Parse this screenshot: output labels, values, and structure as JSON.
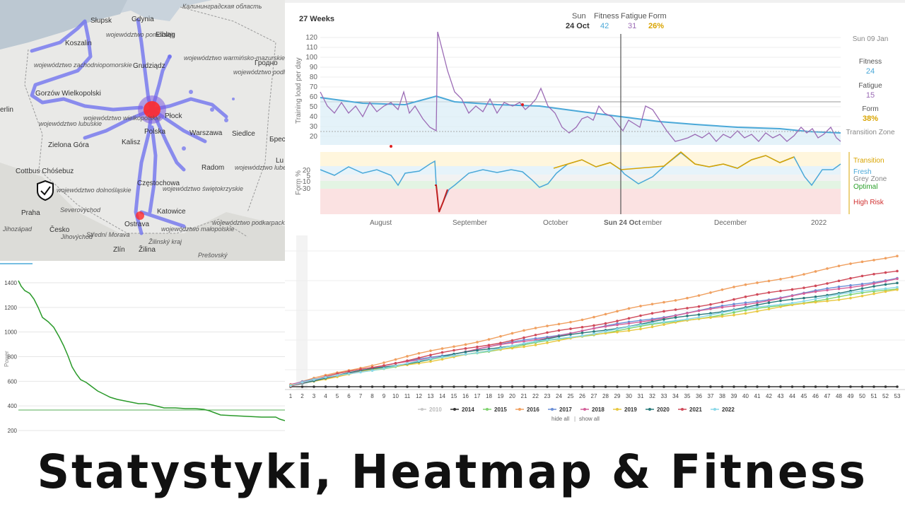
{
  "map": {
    "regions": [
      {
        "id": "zachodniopomorskie",
        "text": "województwo zachodniopomorskie"
      },
      {
        "id": "pomorskie",
        "text": "województwo pomorskie"
      },
      {
        "id": "warminsko",
        "text": "województwo warmińsko-mazurskie"
      },
      {
        "id": "podlaskie",
        "text": "województwo podlaskie"
      },
      {
        "id": "lubuskie",
        "text": "województwo lubuskie"
      },
      {
        "id": "wielkopolskie",
        "text": "województwo wielkopolskie"
      },
      {
        "id": "dolnoslaskie",
        "text": "województwo dolnośląskie"
      },
      {
        "id": "lubelskie",
        "text": "województwo lubelskie"
      },
      {
        "id": "swietokrzyskie",
        "text": "województwo świętokrzyskie"
      },
      {
        "id": "malopolskie",
        "text": "województwo małopolskie"
      },
      {
        "id": "podkarpackie",
        "text": "województwo podkarpackie"
      },
      {
        "id": "kaliningrad",
        "text": "Калининградская область"
      },
      {
        "id": "severovychod",
        "text": "Severovýchod"
      },
      {
        "id": "jihozapad",
        "text": "Jihozápad"
      },
      {
        "id": "jihovychod",
        "text": "Jihovýchod"
      },
      {
        "id": "stredni",
        "text": "Střední Morava"
      },
      {
        "id": "zilina-kraj",
        "text": "Žilinský kraj"
      },
      {
        "id": "presov",
        "text": "Prešovský"
      }
    ],
    "cities": [
      {
        "id": "slupsk",
        "text": "Słupsk"
      },
      {
        "id": "gdynia",
        "text": "Gdynia"
      },
      {
        "id": "elblag",
        "text": "Elbląg"
      },
      {
        "id": "koszalin",
        "text": "Koszalin"
      },
      {
        "id": "grodno",
        "text": "Гродно"
      },
      {
        "id": "grudziadz",
        "text": "Grudziądz"
      },
      {
        "id": "gorzow",
        "text": "Gorzów Wielkopolski"
      },
      {
        "id": "berlin",
        "text": "erlin"
      },
      {
        "id": "plock",
        "text": "Płock"
      },
      {
        "id": "polska",
        "text": "Polska"
      },
      {
        "id": "warszawa",
        "text": "Warszawa"
      },
      {
        "id": "siedlce",
        "text": "Siedlce"
      },
      {
        "id": "brest",
        "text": "Брест"
      },
      {
        "id": "cottbus",
        "text": "Cottbus Chóśebuz"
      },
      {
        "id": "zielona",
        "text": "Zielona Góra"
      },
      {
        "id": "kalisz",
        "text": "Kalisz"
      },
      {
        "id": "radom",
        "text": "Radom"
      },
      {
        "id": "czestochowa",
        "text": "Częstochowa"
      },
      {
        "id": "katowice",
        "text": "Katowice"
      },
      {
        "id": "praha",
        "text": "Praha"
      },
      {
        "id": "cesko",
        "text": "Česko"
      },
      {
        "id": "ostrava",
        "text": "Ostrava"
      },
      {
        "id": "zlin",
        "text": "Zlín"
      },
      {
        "id": "zilina",
        "text": "Žilina"
      },
      {
        "id": "lublin",
        "text": "Lu"
      }
    ]
  },
  "fitness": {
    "range_label": "27 Weeks",
    "header": {
      "day": "Sun",
      "date": "24 Oct",
      "fitness_label": "Fitness",
      "fitness_value": "42",
      "fatigue_label": "Fatigue",
      "fatigue_value": "31",
      "form_label": "Form",
      "form_value": "26%"
    },
    "side": {
      "date": "Sun 09 Jan",
      "fitness_label": "Fitness",
      "fitness_value": "24",
      "fatigue_label": "Fatigue",
      "fatigue_value": "15",
      "form_label": "Form",
      "form_value": "38%",
      "transition_zone": "Transition Zone"
    },
    "y_axis_label": "Training load per day",
    "y_ticks": [
      "120",
      "110",
      "100",
      "90",
      "80",
      "70",
      "60",
      "50",
      "40",
      "30",
      "20"
    ],
    "form_axis_label": "Form %",
    "form_ticks": [
      "20",
      "5",
      "-10",
      "-30"
    ],
    "zones": [
      {
        "label": "Transition",
        "color": "#d9a400"
      },
      {
        "label": "Fresh",
        "color": "#4aa8d8"
      },
      {
        "label": "Grey Zone",
        "color": "#888888"
      },
      {
        "label": "Optimal",
        "color": "#2aa02a"
      },
      {
        "label": "High Risk",
        "color": "#d03030"
      }
    ],
    "x_labels": [
      "August",
      "September",
      "October",
      "Sun 24 Oct",
      "ember",
      "December",
      "2022"
    ],
    "colors": {
      "fitness": "#4aa8d8",
      "fatigue": "#9b6bb5",
      "form": "#d9a400"
    }
  },
  "power": {
    "y_ticks": [
      "1400",
      "1200",
      "1000",
      "800",
      "600",
      "400",
      "200"
    ],
    "y_axis_label": "Power",
    "color": "#2a9a2a"
  },
  "cumulative": {
    "x_ticks": [
      "1",
      "2",
      "3",
      "4",
      "5",
      "6",
      "7",
      "8",
      "9",
      "10",
      "11",
      "12",
      "13",
      "14",
      "15",
      "16",
      "17",
      "18",
      "19",
      "20",
      "21",
      "22",
      "23",
      "24",
      "25",
      "26",
      "27",
      "28",
      "29",
      "30",
      "31",
      "32",
      "33",
      "34",
      "35",
      "36",
      "37",
      "38",
      "39",
      "40",
      "41",
      "42",
      "43",
      "44",
      "45",
      "46",
      "47",
      "48",
      "49",
      "50",
      "51",
      "52",
      "53"
    ],
    "legend": [
      {
        "label": "2010",
        "color": "#c8c8c8"
      },
      {
        "label": "2014",
        "color": "#333333"
      },
      {
        "label": "2015",
        "color": "#7fd36e"
      },
      {
        "label": "2016",
        "color": "#f0a060"
      },
      {
        "label": "2017",
        "color": "#6a8fd6"
      },
      {
        "label": "2018",
        "color": "#d4609a"
      },
      {
        "label": "2019",
        "color": "#e8c840"
      },
      {
        "label": "2020",
        "color": "#2a7a7a"
      },
      {
        "label": "2021",
        "color": "#d04a5a"
      },
      {
        "label": "2022",
        "color": "#8ad8e8"
      }
    ],
    "hide_all": "hide all",
    "separator": "|",
    "show_all": "show all"
  },
  "banner": {
    "title": "Statystyki, Heatmap & Fitness"
  }
}
